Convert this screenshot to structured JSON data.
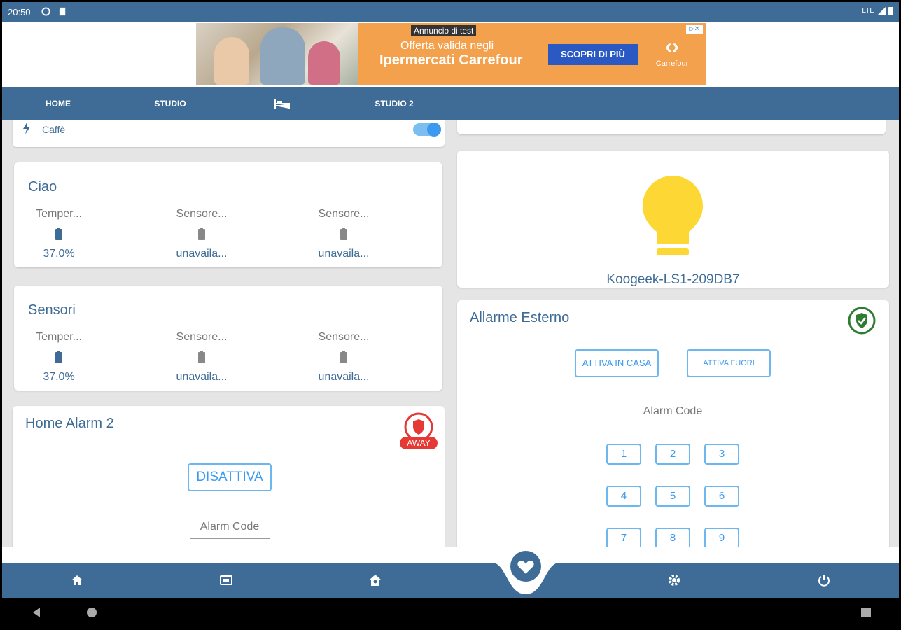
{
  "status_bar": {
    "time": "20:50",
    "network": "LTE"
  },
  "ad": {
    "tag": "Annuncio di test",
    "line1": "Offerta valida negli",
    "line2": "Ipermercati Carrefour",
    "cta": "SCOPRI DI PIÙ",
    "brand": "Carrefour"
  },
  "tabs": [
    {
      "label": "HOME"
    },
    {
      "label": "STUDIO"
    },
    {
      "label": "",
      "icon": "bed-icon"
    },
    {
      "label": "STUDIO 2"
    }
  ],
  "cards": {
    "caffe": {
      "label": "Caffè",
      "toggle_on": true
    },
    "ciao": {
      "title": "Ciao",
      "sensors": [
        {
          "name": "Temper...",
          "value": "37.0%",
          "status": "ok"
        },
        {
          "name": "Sensore...",
          "value": "unavaila...",
          "status": "unavailable"
        },
        {
          "name": "Sensore...",
          "value": "unavaila...",
          "status": "unavailable"
        }
      ]
    },
    "sensori": {
      "title": "Sensori",
      "sensors": [
        {
          "name": "Temper...",
          "value": "37.0%",
          "status": "ok"
        },
        {
          "name": "Sensore...",
          "value": "unavaila...",
          "status": "unavailable"
        },
        {
          "name": "Sensore...",
          "value": "unavaila...",
          "status": "unavailable"
        }
      ]
    },
    "home_alarm_2": {
      "title": "Home Alarm 2",
      "state_badge": "AWAY",
      "disarm_button": "DISATTIVA",
      "code_placeholder": "Alarm Code"
    },
    "light": {
      "name": "Koogeek-LS1-209DB7",
      "state": "on",
      "color": "#fdd835"
    },
    "allarme_esterno": {
      "title": "Allarme Esterno",
      "arm_home_button": "ATTIVA IN CASA",
      "arm_away_button": "ATTIVA FUORI",
      "code_placeholder": "Alarm Code",
      "keypad": [
        "1",
        "2",
        "3",
        "4",
        "5",
        "6",
        "7",
        "8",
        "9"
      ]
    }
  },
  "bottom_nav": [
    "home-icon",
    "dashboard-icon",
    "house-icon",
    "favorite-icon",
    "settings-icon",
    "power-icon"
  ],
  "colors": {
    "primary": "#3f6c96",
    "accent": "#3a9af0",
    "alarm_red": "#e53935",
    "armed_green": "#2e7d32"
  }
}
